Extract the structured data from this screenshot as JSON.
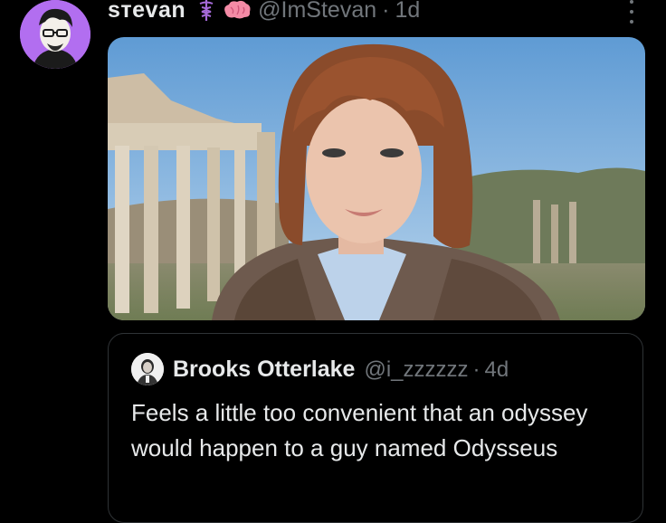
{
  "tweet": {
    "display_name": "sтevan",
    "handle": "@ImStevan",
    "separator": "·",
    "time": "1d",
    "badges": [
      "caduceus-icon",
      "pink-brain-icon"
    ],
    "more_icon": "more-options-icon"
  },
  "quote": {
    "display_name": "Brooks Otterlake",
    "handle": "@i_zzzzzz",
    "separator": "·",
    "time": "4d",
    "text": "Feels a little too convenient that an odyssey would happen to a guy named Odysseus"
  },
  "colors": {
    "avatar_bg": "#b26ef0",
    "text_primary": "#e7e9ea",
    "text_secondary": "#71767b",
    "border": "#2f3336",
    "background": "#000000"
  }
}
